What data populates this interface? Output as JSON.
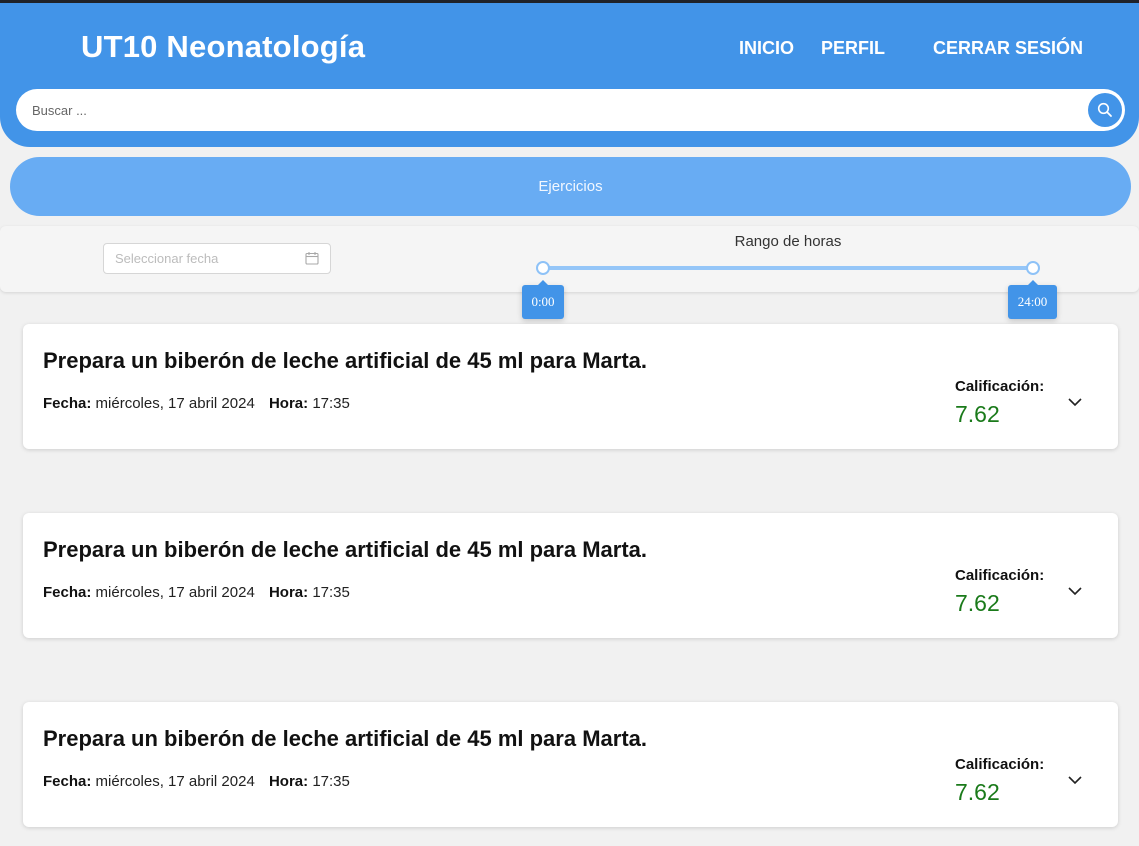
{
  "header": {
    "app_title": "UT10 Neonatología",
    "nav": {
      "home": "INICIO",
      "profile": "PERFIL",
      "logout": "CERRAR SESIÓN"
    }
  },
  "search": {
    "placeholder": "Buscar ...",
    "icon": "search-icon"
  },
  "tabs": {
    "active_label": "Ejercicios"
  },
  "filters": {
    "date_placeholder": "Seleccionar fecha",
    "date_icon": "calendar-icon",
    "range_label": "Rango de horas",
    "range_start": "0:00",
    "range_end": "24:00"
  },
  "exercises": [
    {
      "title": "Prepara un biberón de leche artificial de 45 ml para Marta.",
      "date_label": "Fecha:",
      "date": "miércoles, 17 abril 2024",
      "time_label": "Hora:",
      "time": "17:35",
      "grade_label": "Calificación:",
      "grade": "7.62"
    },
    {
      "title": "Prepara un biberón de leche artificial de 45 ml para Marta.",
      "date_label": "Fecha:",
      "date": "miércoles, 17 abril 2024",
      "time_label": "Hora:",
      "time": "17:35",
      "grade_label": "Calificación:",
      "grade": "7.62"
    },
    {
      "title": "Prepara un biberón de leche artificial de 45 ml para Marta.",
      "date_label": "Fecha:",
      "date": "miércoles, 17 abril 2024",
      "time_label": "Hora:",
      "time": "17:35",
      "grade_label": "Calificación:",
      "grade": "7.62"
    }
  ],
  "colors": {
    "primary": "#4294e8",
    "tab_bar": "#68acf3",
    "grade": "#1a7a1a",
    "background": "#f1f1f1"
  }
}
